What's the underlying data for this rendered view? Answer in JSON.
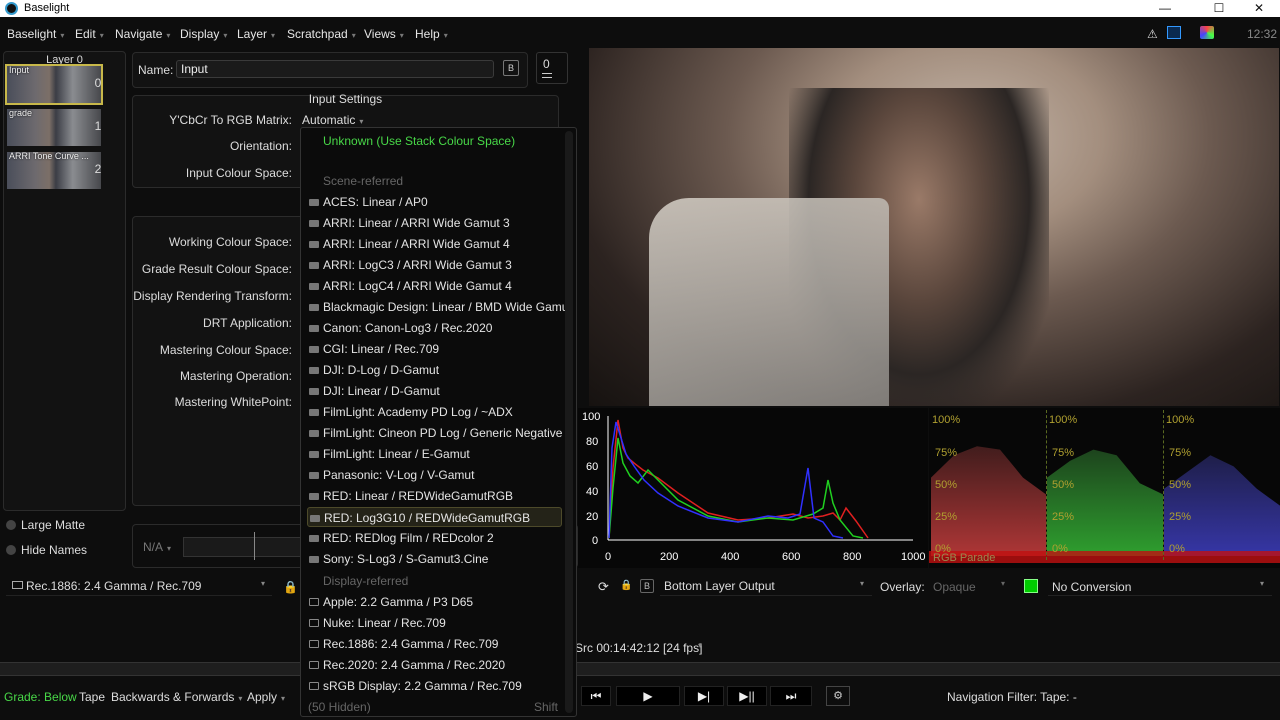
{
  "window": {
    "title": "Baselight"
  },
  "menu": {
    "items": [
      {
        "label": "Baselight"
      },
      {
        "label": "Edit"
      },
      {
        "label": "Navigate"
      },
      {
        "label": "Display"
      },
      {
        "label": "Layer"
      },
      {
        "label": "Scratchpad"
      },
      {
        "label": "Views"
      },
      {
        "label": "Help"
      }
    ],
    "clock": "12:32"
  },
  "layers": {
    "header": "Layer 0",
    "items": [
      {
        "label": "Input",
        "num": "0"
      },
      {
        "label": "grade",
        "num": "1"
      },
      {
        "label": "ARRI Tone Curve ...",
        "num": "2"
      }
    ],
    "large_matte": "Large Matte",
    "hide_names": "Hide Names"
  },
  "name_field": {
    "label": "Name:",
    "value": "Input",
    "count": "0"
  },
  "input_settings": {
    "title": "Input Settings",
    "ycbcr_label": "Y'CbCr To RGB Matrix:",
    "ycbcr_value": "Automatic",
    "orientation_label": "Orientation:",
    "input_cs_label": "Input Colour Space:"
  },
  "stack_settings": {
    "working_cs": "Working Colour Space:",
    "grade_result_cs": "Grade Result Colour Space:",
    "drt": "Display Rendering Transform:",
    "drt_application": "DRT Application:",
    "mastering_cs": "Mastering Colour Space:",
    "mastering_op": "Mastering Operation:",
    "mastering_wp": "Mastering WhitePoint:"
  },
  "dropdown": {
    "unknown": "Unknown (Use Stack Colour Space)",
    "scene_header": "Scene-referred",
    "scene_items": [
      "ACES: Linear / AP0",
      "ARRI: Linear / ARRI Wide Gamut 3",
      "ARRI: Linear / ARRI Wide Gamut 4",
      "ARRI: LogC3 / ARRI Wide Gamut 3",
      "ARRI: LogC4 / ARRI Wide Gamut 4",
      "Blackmagic Design: Linear / BMD Wide Gamut",
      "Canon: Canon-Log3 / Rec.2020",
      "CGI: Linear / Rec.709",
      "DJI: D-Log / D-Gamut",
      "DJI: Linear / D-Gamut",
      "FilmLight: Academy PD Log / ~ADX",
      "FilmLight: Cineon PD Log / Generic Negative",
      "FilmLight: Linear / E-Gamut",
      "Panasonic: V-Log / V-Gamut",
      "RED: Linear / REDWideGamutRGB",
      "RED: Log3G10 / REDWideGamutRGB",
      "RED: REDlog Film / REDcolor 2",
      "Sony: S-Log3 / S-Gamut3.Cine"
    ],
    "display_header": "Display-referred",
    "display_items": [
      "Apple: 2.2 Gamma / P3 D65",
      "Nuke: Linear / Rec.709",
      "Rec.1886: 2.4 Gamma / Rec.709",
      "Rec.2020: 2.4 Gamma / Rec.2020",
      "sRGB Display: 2.2 Gamma / Rec.709"
    ],
    "hidden": "(50 Hidden)",
    "shift": "Shift"
  },
  "histogram": {
    "y_ticks": [
      "100",
      "80",
      "60",
      "40",
      "20",
      "0"
    ],
    "x_ticks": [
      "0",
      "200",
      "400",
      "600",
      "800",
      "1000"
    ]
  },
  "parade": {
    "labels_100": [
      "100%",
      "100%",
      "100%"
    ],
    "labels_75": [
      "75%",
      "75%",
      "75%"
    ],
    "labels_50": [
      "50%",
      "50%",
      "50%"
    ],
    "labels_25": [
      "25%",
      "25%",
      "25%"
    ],
    "labels_0": [
      "0%",
      "0%",
      "0%"
    ],
    "title": "RGB Parade"
  },
  "bottom": {
    "display_cs": "Rec.1886: 2.4 Gamma / Rec.709",
    "na": "N/A",
    "bottom_layer": "Bottom Layer Output",
    "overlay_label": "Overlay:",
    "overlay_value": "Opaque",
    "conversion": "No Conversion",
    "src_timecode": "Src 00:14:42:12 [24 fps]",
    "grade_label": "Grade:",
    "grade_value": "Below",
    "tape": "Tape",
    "direction": "Backwards & Forwards",
    "apply": "Apply",
    "nav_filter": "Navigation Filter: Tape: -"
  },
  "colors": {
    "accent_green": "#48d848",
    "selection": "#c8b84a",
    "red": "#e02020",
    "green": "#20d020",
    "blue": "#3030ff"
  }
}
